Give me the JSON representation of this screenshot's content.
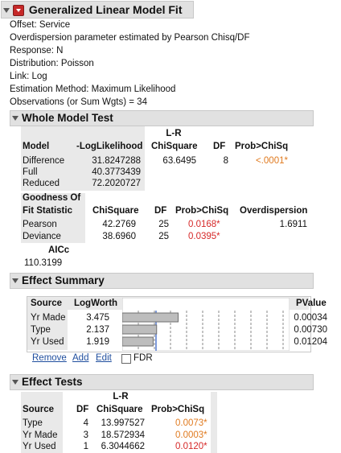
{
  "title": "Generalized Linear Model Fit",
  "info": [
    "Offset: Service",
    "Overdispersion parameter estimated by Pearson Chisq/DF",
    "Response: N",
    "Distribution: Poisson",
    "Link: Log",
    "Estimation Method: Maximum Likelihood",
    "Observations (or Sum Wgts) = 34"
  ],
  "whole_model": {
    "title": "Whole Model Test",
    "headers": {
      "model": "Model",
      "loglik": "-LogLikelihood",
      "lr1": "L-R",
      "lr2": "ChiSquare",
      "df": "DF",
      "prob": "Prob>ChiSq"
    },
    "rows": [
      {
        "model": "Difference",
        "loglik": "31.8247288",
        "chisq": "63.6495",
        "df": "8",
        "prob": "<.0001*"
      },
      {
        "model": "Full",
        "loglik": "40.3773439"
      },
      {
        "model": "Reduced",
        "loglik": "72.2020727"
      }
    ],
    "gof_headers": {
      "stat1": "Goodness Of",
      "stat2": "Fit Statistic",
      "chisq": "ChiSquare",
      "df": "DF",
      "prob": "Prob>ChiSq",
      "over": "Overdispersion"
    },
    "gof_rows": [
      {
        "stat": "Pearson",
        "chisq": "42.2769",
        "df": "25",
        "prob": "0.0168*",
        "over": "1.6911"
      },
      {
        "stat": "Deviance",
        "chisq": "38.6960",
        "df": "25",
        "prob": "0.0395*"
      }
    ],
    "aicc_label": "AICc",
    "aicc_value": "110.3199"
  },
  "effect_summary": {
    "title": "Effect Summary",
    "headers": {
      "source": "Source",
      "logworth": "LogWorth",
      "pvalue": "PValue"
    },
    "rows": [
      {
        "source": "Yr Made",
        "logworth": "3.475",
        "pvalue": "0.00034",
        "bar": 3.475
      },
      {
        "source": "Type",
        "logworth": "2.137",
        "pvalue": "0.00730",
        "bar": 2.137
      },
      {
        "source": "Yr Used",
        "logworth": "1.919",
        "pvalue": "0.01204",
        "bar": 1.919
      }
    ],
    "buttons": {
      "remove": "Remove",
      "add": "Add",
      "edit": "Edit"
    },
    "fdr_label": "FDR"
  },
  "effect_tests": {
    "title": "Effect Tests",
    "headers": {
      "source": "Source",
      "df": "DF",
      "lr1": "L-R",
      "lr2": "ChiSquare",
      "prob": "Prob>ChiSq"
    },
    "rows": [
      {
        "source": "Type",
        "df": "4",
        "chisq": "13.997527",
        "prob": "0.0073*"
      },
      {
        "source": "Yr Made",
        "df": "3",
        "chisq": "18.572934",
        "prob": "0.0003*"
      },
      {
        "source": "Yr Used",
        "df": "1",
        "chisq": "6.3044662",
        "prob": "0.0120*"
      }
    ]
  }
}
